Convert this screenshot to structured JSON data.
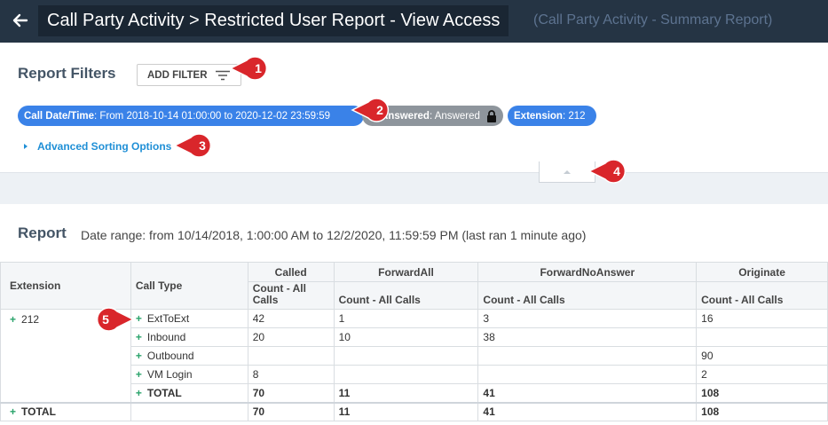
{
  "header": {
    "title": "Call Party Activity > Restricted User Report - View Access",
    "subtitle": "(Call Party Activity - Summary Report)"
  },
  "filters": {
    "title": "Report Filters",
    "add_filter_label": "ADD FILTER",
    "chips": [
      {
        "key": "Call Date/Time",
        "value": ": From 2018-10-14 01:00:00 to 2020-12-02 23:59:59"
      },
      {
        "key": "Answered",
        "value": ": Answered"
      },
      {
        "key": "Extension",
        "value": ": 212"
      }
    ],
    "advanced_sorting": "Advanced Sorting Options"
  },
  "report": {
    "title": "Report",
    "date_range": "Date range: from 10/14/2018, 1:00:00 AM to 12/2/2020, 11:59:59 PM (last ran 1 minute ago)"
  },
  "table": {
    "col_extension": "Extension",
    "col_call_type": "Call Type",
    "groups": [
      "Called",
      "ForwardAll",
      "ForwardNoAnswer",
      "Originate"
    ],
    "sub_headers": [
      "Count - All Calls",
      "Count - All Calls",
      "Count - All Calls",
      "Count - All Calls"
    ],
    "extension": "212",
    "rows": [
      {
        "call_type": "ExtToExt",
        "values": [
          "42",
          "1",
          "3",
          "16"
        ]
      },
      {
        "call_type": "Inbound",
        "values": [
          "20",
          "10",
          "38",
          ""
        ]
      },
      {
        "call_type": "Outbound",
        "values": [
          "",
          "",
          "",
          "90"
        ]
      },
      {
        "call_type": "VM Login",
        "values": [
          "8",
          "",
          "",
          "2"
        ]
      },
      {
        "call_type": "TOTAL",
        "values": [
          "70",
          "11",
          "41",
          "108"
        ]
      }
    ],
    "grand_total": {
      "label": "TOTAL",
      "values": [
        "70",
        "11",
        "41",
        "108"
      ]
    }
  },
  "annotations": [
    "1",
    "2",
    "3",
    "4",
    "5"
  ],
  "colors": {
    "header_bg": "#253444",
    "chip_blue": "#3a82e8",
    "chip_gray": "#8e959c",
    "link_blue": "#1f8fd6",
    "plus_green": "#2aa36b",
    "badge_red": "#d9262b"
  }
}
